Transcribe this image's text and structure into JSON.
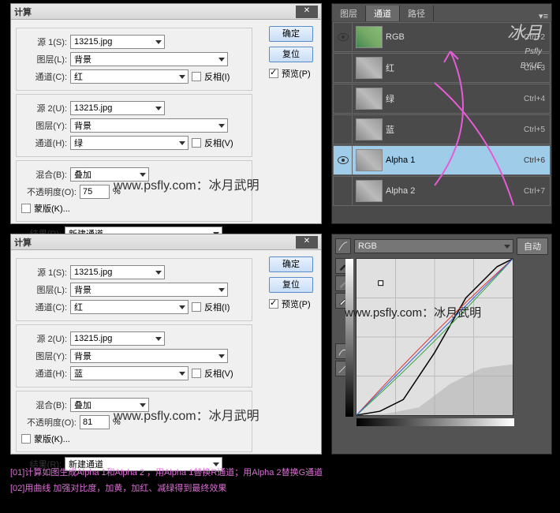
{
  "dialog1": {
    "title": "计算",
    "src1Label": "源 1(S):",
    "src1": "13215.jpg",
    "layerLabel": "图层(L):",
    "layer1": "背景",
    "chanLabel": "通道(C):",
    "chan1": "红",
    "invert1Label": "反相(I)",
    "invert1": false,
    "src2Label": "源 2(U):",
    "src2": "13215.jpg",
    "layer2Label": "图层(Y):",
    "layer2": "背景",
    "chan2Label": "通道(H):",
    "chan2": "绿",
    "invert2Label": "反相(V)",
    "invert2": false,
    "blendLabel": "混合(B):",
    "blend": "叠加",
    "opacityLabel": "不透明度(O):",
    "opacity": "75",
    "pct": "%",
    "maskLabel": "蒙版(K)...",
    "mask": false,
    "resultLabel": "结果(R):",
    "result": "新建通道",
    "ok": "确定",
    "reset": "复位",
    "previewLabel": "预览(P)",
    "preview": true,
    "watermark": "www.psfly.com：冰月武明"
  },
  "dialog2": {
    "title": "计算",
    "src1Label": "源 1(S):",
    "src1": "13215.jpg",
    "layerLabel": "图层(L):",
    "layer1": "背景",
    "chanLabel": "通道(C):",
    "chan1": "红",
    "invert1Label": "反相(I)",
    "invert1": false,
    "src2Label": "源 2(U):",
    "src2": "13215.jpg",
    "layer2Label": "图层(Y):",
    "layer2": "背景",
    "chan2Label": "通道(H):",
    "chan2": "蓝",
    "invert2Label": "反相(V)",
    "invert2": false,
    "blendLabel": "混合(B):",
    "blend": "叠加",
    "opacityLabel": "不透明度(O):",
    "opacity": "81",
    "pct": "%",
    "maskLabel": "蒙版(K)...",
    "mask": false,
    "resultLabel": "结果(R):",
    "result": "新建通道",
    "ok": "确定",
    "reset": "复位",
    "previewLabel": "预览(P)",
    "preview": true,
    "watermark": "www.psfly.com：冰月武明"
  },
  "channels": {
    "tabs": [
      "图层",
      "通道",
      "路径"
    ],
    "activeTab": 1,
    "rows": [
      {
        "name": "RGB",
        "shortcut": "Ctrl+2",
        "eye": true,
        "rgb": true,
        "sel": false
      },
      {
        "name": "红",
        "shortcut": "Ctrl+3",
        "eye": false,
        "rgb": false,
        "sel": false
      },
      {
        "name": "绿",
        "shortcut": "Ctrl+4",
        "eye": false,
        "rgb": false,
        "sel": false
      },
      {
        "name": "蓝",
        "shortcut": "Ctrl+5",
        "eye": false,
        "rgb": false,
        "sel": false
      },
      {
        "name": "Alpha 1",
        "shortcut": "Ctrl+6",
        "eye": true,
        "rgb": false,
        "sel": true
      },
      {
        "name": "Alpha 2",
        "shortcut": "Ctrl+7",
        "eye": false,
        "rgb": false,
        "sel": false
      }
    ],
    "sig1": "冰月",
    "sig2": "Psfly",
    "sig3": "BYUE"
  },
  "curves": {
    "channelSel": "RGB",
    "auto": "自动",
    "watermark": "www.psfly.com：冰月武明"
  },
  "instructions": {
    "line1": "[01]计算如图生成Alpha 1和Alpha 2 ，用Alpha 1替换R通道；用Alpha 2替换G通道",
    "line2": "[02]用曲线 加强对比度，加黄，加红、减绿得到最终效果"
  }
}
